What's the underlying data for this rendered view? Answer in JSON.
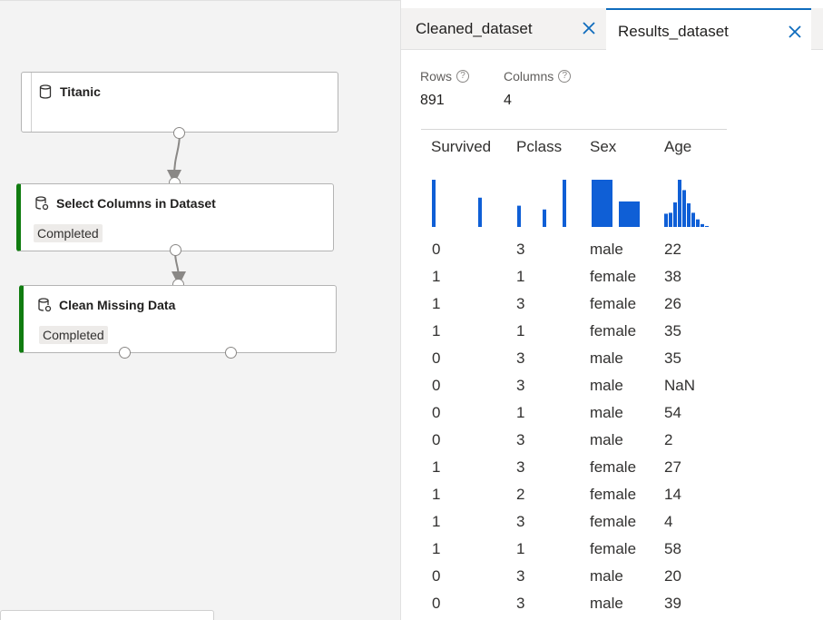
{
  "canvas": {
    "nodes": [
      {
        "title": "Titanic",
        "status": "",
        "icon": "dataset-icon"
      },
      {
        "title": "Select Columns in Dataset",
        "status": "Completed",
        "icon": "module-icon"
      },
      {
        "title": "Clean Missing Data",
        "status": "Completed",
        "icon": "module-icon"
      }
    ],
    "accent_completed": "#107c10"
  },
  "panel": {
    "tabs": [
      {
        "label": "Cleaned_dataset",
        "active": false
      },
      {
        "label": "Results_dataset",
        "active": true
      }
    ],
    "rows_label": "Rows",
    "rows_value": "891",
    "columns_label": "Columns",
    "columns_value": "4",
    "help_glyph": "?",
    "headers": [
      "Survived",
      "Pclass",
      "Sex",
      "Age"
    ],
    "histogram_color": "#0f5fd6",
    "histograms": {
      "survived": [
        1,
        0.62
      ],
      "pclass": [
        0.45,
        0.37,
        1
      ],
      "sex": [
        1,
        0.54
      ],
      "age": [
        0.28,
        0.3,
        0.52,
        1,
        0.78,
        0.5,
        0.3,
        0.16,
        0.06,
        0.02
      ]
    },
    "rows": [
      [
        "0",
        "3",
        "male",
        "22"
      ],
      [
        "1",
        "1",
        "female",
        "38"
      ],
      [
        "1",
        "3",
        "female",
        "26"
      ],
      [
        "1",
        "1",
        "female",
        "35"
      ],
      [
        "0",
        "3",
        "male",
        "35"
      ],
      [
        "0",
        "3",
        "male",
        "NaN"
      ],
      [
        "0",
        "1",
        "male",
        "54"
      ],
      [
        "0",
        "3",
        "male",
        "2"
      ],
      [
        "1",
        "3",
        "female",
        "27"
      ],
      [
        "1",
        "2",
        "female",
        "14"
      ],
      [
        "1",
        "3",
        "female",
        "4"
      ],
      [
        "1",
        "1",
        "female",
        "58"
      ],
      [
        "0",
        "3",
        "male",
        "20"
      ],
      [
        "0",
        "3",
        "male",
        "39"
      ]
    ]
  }
}
